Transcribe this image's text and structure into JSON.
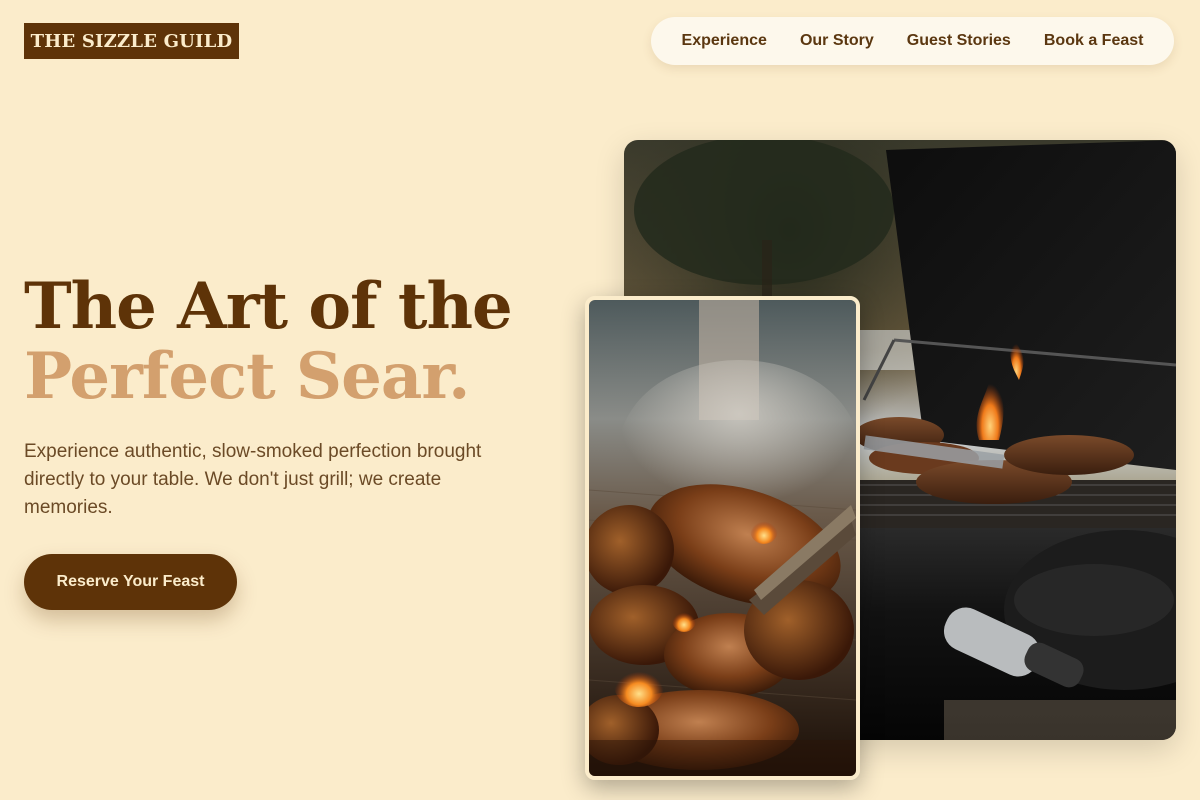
{
  "brand": {
    "logo_text": "THE SIZZLE GUILD"
  },
  "nav": {
    "items": [
      {
        "label": "Experience"
      },
      {
        "label": "Our Story"
      },
      {
        "label": "Guest Stories"
      },
      {
        "label": "Book a Feast"
      }
    ]
  },
  "hero": {
    "headline_line1": "The Art of the",
    "headline_line2": "Perfect Sear.",
    "description": "Experience authentic, slow-smoked perfection brought directly to your table. We don't just grill; we create memories.",
    "cta_label": "Reserve Your Feast"
  },
  "images": [
    {
      "name": "grill-photo-large",
      "subject": "open barbecue grill with steaks and flames"
    },
    {
      "name": "grill-photo-small",
      "subject": "chicken and pork searing on grill grate with tongs and smoke"
    }
  ],
  "colors": {
    "background": "#fbeccb",
    "brand_dark": "#5e3308",
    "accent": "#d3a06e",
    "nav_bg": "#fdf8ec",
    "text_body": "#6b4a26"
  }
}
